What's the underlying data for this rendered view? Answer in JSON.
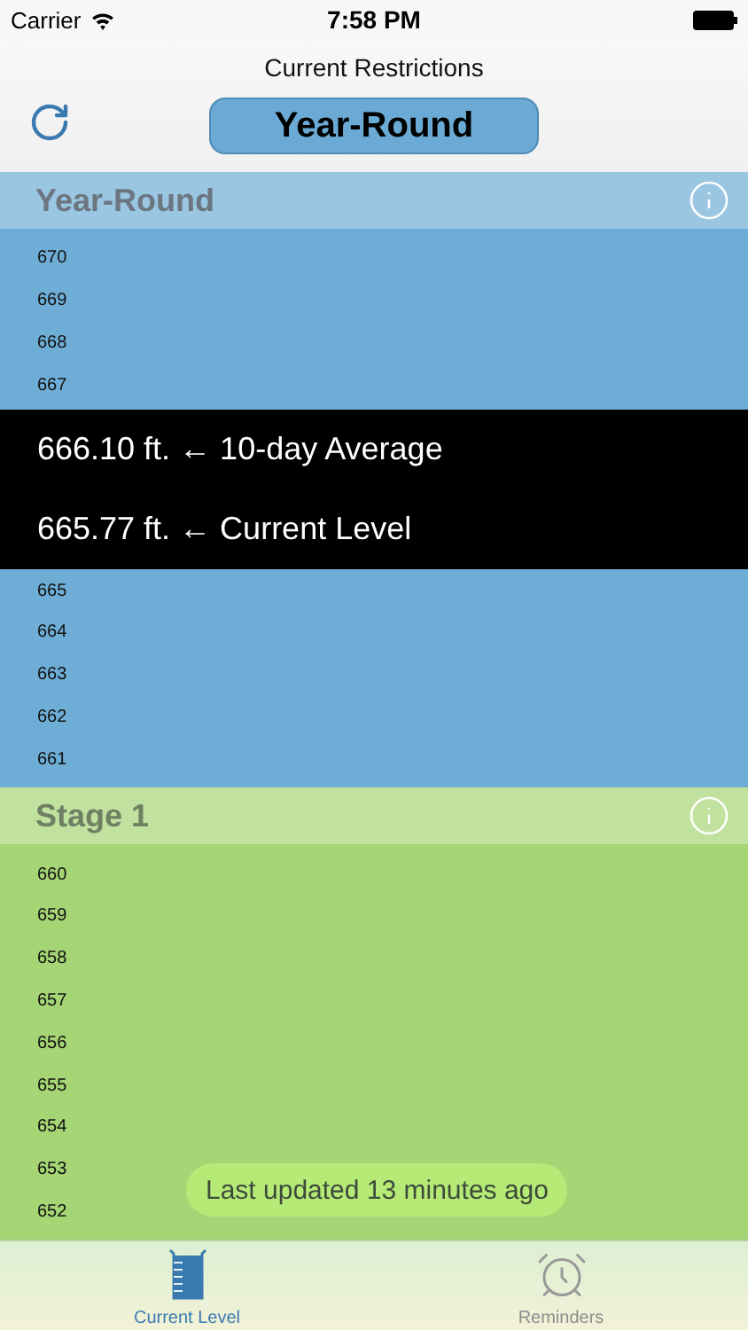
{
  "status_bar": {
    "carrier": "Carrier",
    "time": "7:58 PM"
  },
  "nav": {
    "title": "Current Restrictions",
    "segment": "Year-Round"
  },
  "sections": [
    {
      "title": "Year-Round",
      "color": "#6eaed6",
      "rows_before": [
        "670",
        "669",
        "668",
        "667"
      ],
      "readings": [
        {
          "value": "666.10 ft. ← 10-day Average"
        },
        {
          "value": "665.77 ft. ← Current Level"
        }
      ],
      "rows_after": [
        "665",
        "664",
        "663",
        "662",
        "661"
      ]
    },
    {
      "title": "Stage 1",
      "color": "#a5d574",
      "rows_before": [
        "660",
        "659",
        "658",
        "657",
        "656",
        "655",
        "654",
        "653",
        "652"
      ]
    }
  ],
  "toast": "Last updated 13 minutes ago",
  "tabs": [
    {
      "label": "Current Level",
      "kind": "beaker",
      "selected": true
    },
    {
      "label": "Reminders",
      "kind": "clock",
      "selected": false
    }
  ]
}
